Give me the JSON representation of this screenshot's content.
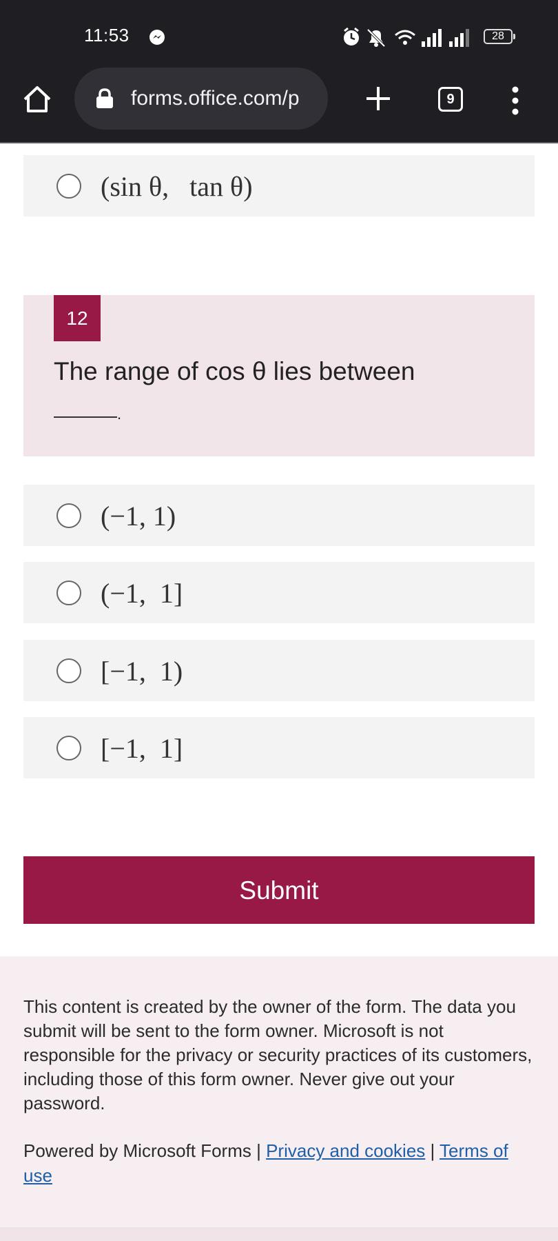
{
  "status_bar": {
    "time": "11:53",
    "battery": "28"
  },
  "browser": {
    "url": "forms.office.com/p",
    "tab_count": "9"
  },
  "previous_question": {
    "last_option": "(sin θ,   tan θ)"
  },
  "question": {
    "number": "12",
    "text": "The range of cos θ lies between",
    "period": ".",
    "options": [
      "(−1, 1)",
      "(−1,  1]",
      "[−1,  1)",
      "[−1,  1]"
    ]
  },
  "submit_label": "Submit",
  "footer": {
    "disclaimer": "This content is created by the owner of the form. The data you submit will be sent to the form owner. Microsoft is not responsible for the privacy or security practices of its customers, including those of this form owner. Never give out your password.",
    "powered_by": "Powered by Microsoft Forms | ",
    "privacy_link": "Privacy and cookies",
    "separator": " | ",
    "terms_link": "Terms of use"
  },
  "colors": {
    "accent": "#981846",
    "question_background": "#f2e5e9",
    "option_background": "#f3f3f3",
    "chrome_background": "#1f1f23",
    "link": "#1f5fa8"
  },
  "icons": [
    "messenger-icon",
    "alarm-icon",
    "mute-icon",
    "wifi-icon",
    "signal-icon",
    "battery-icon",
    "home-icon",
    "lock-icon",
    "plus-icon",
    "tabs-icon",
    "menu-icon"
  ]
}
